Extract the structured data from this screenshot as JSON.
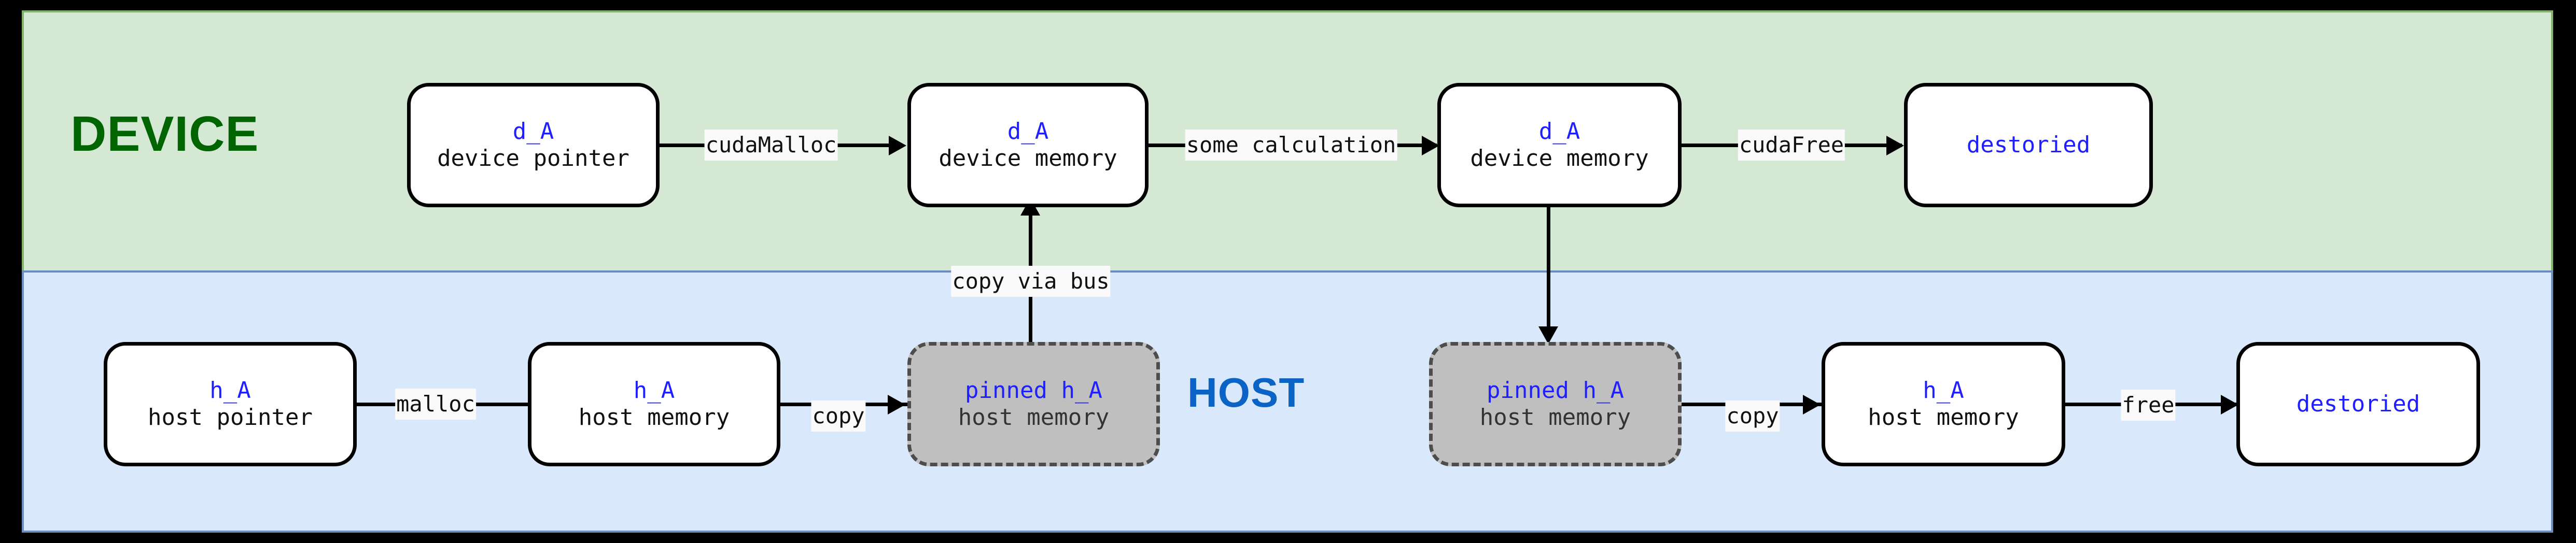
{
  "diagram": {
    "clusters": [
      {
        "id": "device",
        "title": "DEVICE",
        "color": "#006400",
        "fill": "#d5e8d4",
        "stroke": "#82b366"
      },
      {
        "id": "host",
        "title": "HOST",
        "color": "#0b63c5",
        "fill": "#dae8fc",
        "stroke": "#6c8ebf"
      }
    ],
    "nodes": [
      {
        "id": "d_ptr",
        "var": "d_A",
        "desc": "device pointer",
        "style": "solid",
        "cluster": "device"
      },
      {
        "id": "d_mem1",
        "var": "d_A",
        "desc": "device memory",
        "style": "solid",
        "cluster": "device"
      },
      {
        "id": "d_mem2",
        "var": "d_A",
        "desc": "device memory",
        "style": "solid",
        "cluster": "device"
      },
      {
        "id": "d_destroyed",
        "var": "destoried",
        "desc": "",
        "style": "solid",
        "cluster": "device"
      },
      {
        "id": "h_ptr",
        "var": "h_A",
        "desc": "host pointer",
        "style": "solid",
        "cluster": "host"
      },
      {
        "id": "h_mem1",
        "var": "h_A",
        "desc": "host memory",
        "style": "solid",
        "cluster": "host"
      },
      {
        "id": "h_pinned1",
        "var": "pinned h_A",
        "desc": "host memory",
        "style": "dashed",
        "cluster": "host"
      },
      {
        "id": "h_pinned2",
        "var": "pinned h_A",
        "desc": "host memory",
        "style": "dashed",
        "cluster": "host"
      },
      {
        "id": "h_mem2",
        "var": "h_A",
        "desc": "host memory",
        "style": "solid",
        "cluster": "host"
      },
      {
        "id": "h_destroyed",
        "var": "destoried",
        "desc": "",
        "style": "solid",
        "cluster": "host"
      }
    ],
    "edges": [
      {
        "id": "e1",
        "from": "d_ptr",
        "to": "d_mem1",
        "label": "cudaMalloc",
        "direction": "right"
      },
      {
        "id": "e2",
        "from": "d_mem1",
        "to": "d_mem2",
        "label": "some calculation",
        "direction": "right"
      },
      {
        "id": "e3",
        "from": "d_mem2",
        "to": "d_destroyed",
        "label": "cudaFree",
        "direction": "right"
      },
      {
        "id": "e4",
        "from": "h_ptr",
        "to": "h_mem1",
        "label": "malloc",
        "direction": "right"
      },
      {
        "id": "e5",
        "from": "h_mem1",
        "to": "h_pinned1",
        "label": "copy",
        "direction": "right"
      },
      {
        "id": "e6",
        "from": "h_pinned1",
        "to": "d_mem1",
        "label": "copy via bus",
        "direction": "up"
      },
      {
        "id": "e7",
        "from": "d_mem2",
        "to": "h_pinned2",
        "label": "",
        "direction": "down"
      },
      {
        "id": "e8",
        "from": "h_pinned2",
        "to": "h_mem2",
        "label": "copy",
        "direction": "right"
      },
      {
        "id": "e9",
        "from": "h_mem2",
        "to": "h_destroyed",
        "label": "free",
        "direction": "right"
      }
    ],
    "colors": {
      "variable_text": "#2020ff",
      "node_border": "#000000",
      "pinned_fill": "#bfbfbf",
      "pinned_border": "#4d4d4d",
      "edge": "#000000",
      "page_background": "#000000"
    }
  }
}
